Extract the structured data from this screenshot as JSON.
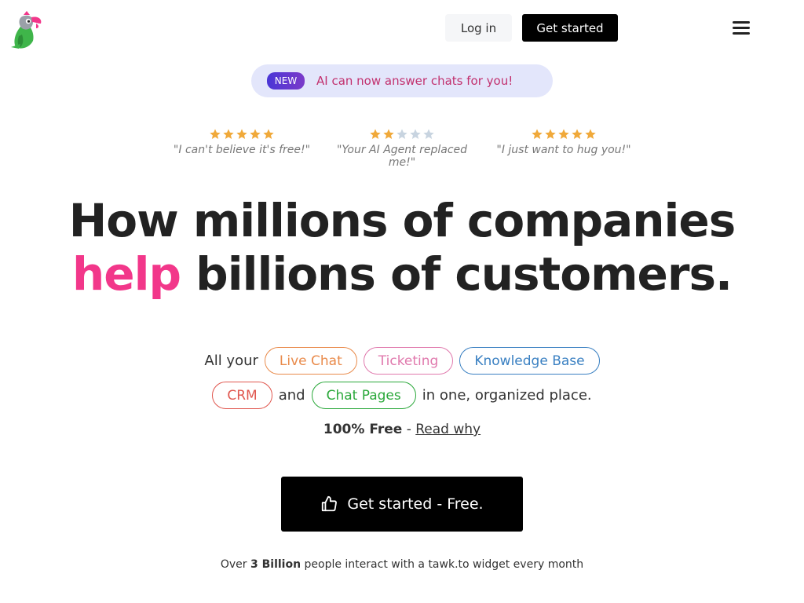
{
  "header": {
    "login_label": "Log in",
    "get_started_label": "Get started"
  },
  "announcement": {
    "badge": "NEW",
    "text": "AI can now answer chats for you!"
  },
  "reviews": [
    {
      "stars": 5,
      "quote": "\"I can't believe it's free!\""
    },
    {
      "stars": 2,
      "quote": "\"Your AI Agent replaced me!\""
    },
    {
      "stars": 5,
      "quote": "\"I just want to hug you!\""
    }
  ],
  "headline": {
    "line1": "How millions of companies",
    "accent": "help",
    "line2_rest": "billions of customers."
  },
  "features": {
    "prefix": "All your",
    "live_chat": "Live Chat",
    "ticketing": "Ticketing",
    "knowledge_base": "Knowledge Base",
    "crm": "CRM",
    "and": "and",
    "chat_pages": "Chat Pages",
    "suffix": "in one, organized place."
  },
  "free": {
    "bold": "100% Free",
    "dash": "-",
    "link": "Read why"
  },
  "cta": {
    "label": "Get started - Free."
  },
  "footer_note": {
    "pre": "Over",
    "bold": "3 Billion",
    "post": "people interact with a tawk.to widget every month"
  },
  "colors": {
    "accent_pink": "#f2378a",
    "star_gold": "#f0a93a",
    "star_empty": "#c8d4e0"
  }
}
